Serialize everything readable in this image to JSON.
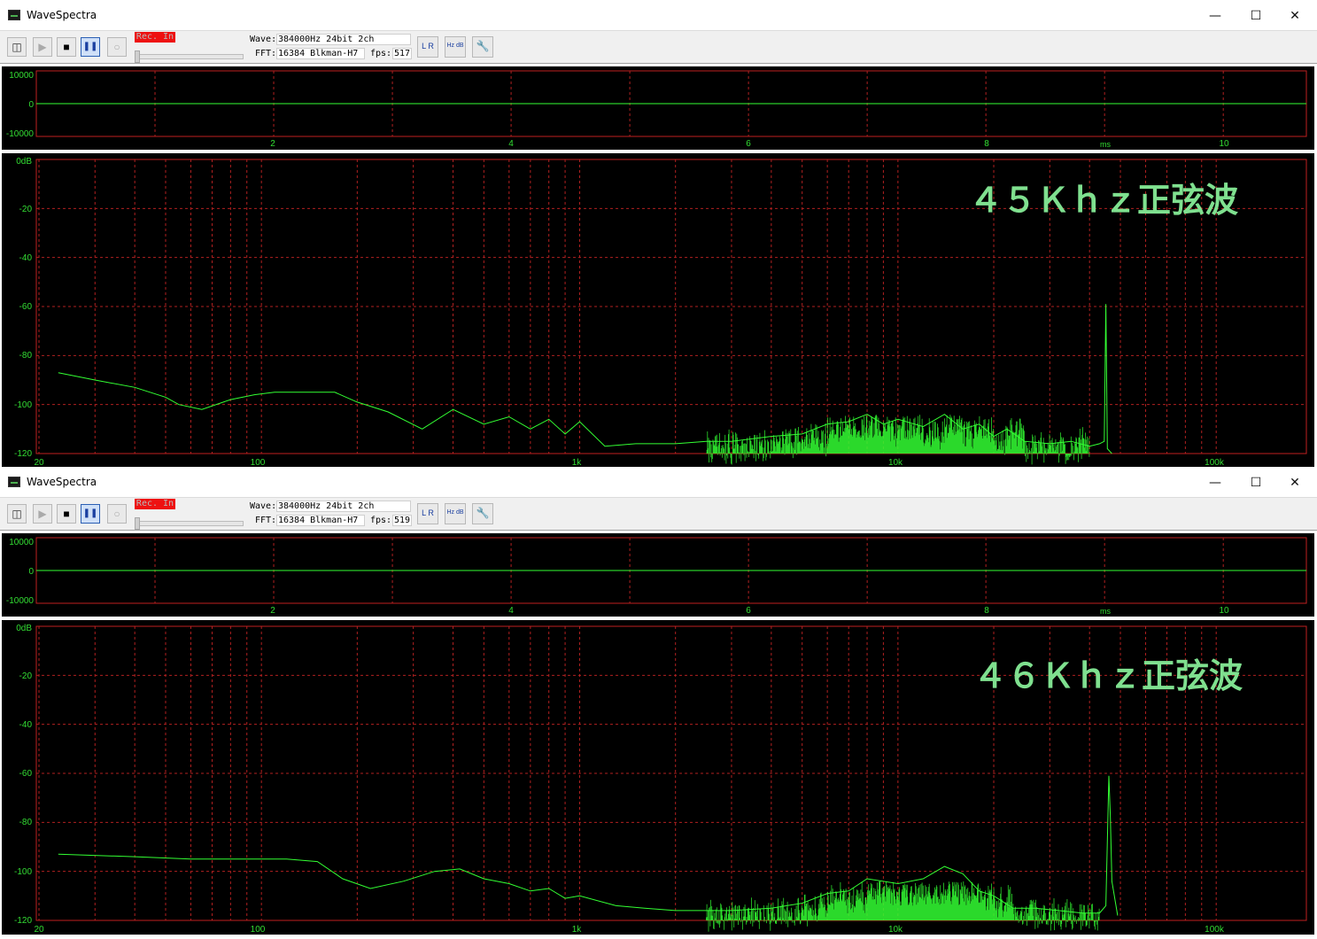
{
  "windows": [
    {
      "title": "WaveSpectra",
      "controls": {
        "minimize": "—",
        "maximize": "☐",
        "close": "✕"
      },
      "toolbar": {
        "rec_label": "Rec. In",
        "wave_label": "Wave:",
        "wave_value": "384000Hz 24bit 2ch",
        "fft_label": "FFT:",
        "fft_value": "16384 Blkman-H7",
        "fps_label": "fps:",
        "fps_value": "517",
        "buttons": [
          {
            "name": "device-icon",
            "glyph": "◫",
            "active": false
          },
          {
            "name": "play-icon",
            "glyph": "▶",
            "active": false
          },
          {
            "name": "stop-icon",
            "glyph": "■",
            "active": false
          },
          {
            "name": "pause-icon",
            "glyph": "❚❚",
            "active": true
          },
          {
            "name": "record-icon",
            "glyph": "○",
            "active": false
          }
        ],
        "right_buttons": [
          {
            "name": "channel-lr-icon",
            "glyph": "L R"
          },
          {
            "name": "hz-db-icon",
            "glyph": "Hz dB"
          },
          {
            "name": "settings-wrench-icon",
            "glyph": "🔧"
          }
        ]
      },
      "waveform": {
        "y_ticks": [
          "10000",
          "0",
          "-10000"
        ],
        "x_ticks": [
          "2",
          "4",
          "6",
          "8",
          "10"
        ],
        "x_unit": "ms"
      },
      "spectrum": {
        "annotation": "４５Ｋｈｚ正弦波",
        "y_ticks": [
          "0dB",
          "-20",
          "-40",
          "-60",
          "-80",
          "-100",
          "-120"
        ],
        "x_ticks": [
          "20",
          "100",
          "1k",
          "10k",
          "100k"
        ]
      }
    },
    {
      "title": "WaveSpectra",
      "controls": {
        "minimize": "—",
        "maximize": "☐",
        "close": "✕"
      },
      "toolbar": {
        "rec_label": "Rec. In",
        "wave_label": "Wave:",
        "wave_value": "384000Hz 24bit 2ch",
        "fft_label": "FFT:",
        "fft_value": "16384 Blkman-H7",
        "fps_label": "fps:",
        "fps_value": "519",
        "buttons": [
          {
            "name": "device-icon",
            "glyph": "◫",
            "active": false
          },
          {
            "name": "play-icon",
            "glyph": "▶",
            "active": false
          },
          {
            "name": "stop-icon",
            "glyph": "■",
            "active": false
          },
          {
            "name": "pause-icon",
            "glyph": "❚❚",
            "active": true
          },
          {
            "name": "record-icon",
            "glyph": "○",
            "active": false
          }
        ],
        "right_buttons": [
          {
            "name": "channel-lr-icon",
            "glyph": "L R"
          },
          {
            "name": "hz-db-icon",
            "glyph": "Hz dB"
          },
          {
            "name": "settings-wrench-icon",
            "glyph": "🔧"
          }
        ]
      },
      "waveform": {
        "y_ticks": [
          "10000",
          "0",
          "-10000"
        ],
        "x_ticks": [
          "2",
          "4",
          "6",
          "8",
          "10"
        ],
        "x_unit": "ms"
      },
      "spectrum": {
        "annotation": "４６Ｋｈｚ正弦波",
        "y_ticks": [
          "0dB",
          "-20",
          "-40",
          "-60",
          "-80",
          "-100",
          "-120"
        ],
        "x_ticks": [
          "20",
          "100",
          "1k",
          "10k",
          "100k"
        ]
      }
    }
  ],
  "colors": {
    "plot_bg": "#000000",
    "grid": "#b02020",
    "trace": "#33ff33",
    "axis_text": "#33dd33",
    "annotation": "#7fe08f"
  },
  "chart_data": [
    {
      "type": "line",
      "title": "",
      "xlabel": "ms",
      "ylabel": "",
      "xlim": [
        0,
        10.7
      ],
      "ylim": [
        -10000,
        10000
      ],
      "x": [
        0,
        10.7
      ],
      "series": [
        {
          "values": [
            0,
            0
          ]
        }
      ]
    },
    {
      "type": "line",
      "title": "４５Ｋｈｚ正弦波",
      "xlabel": "",
      "ylabel": "",
      "x_scale": "log",
      "xlim": [
        20,
        192000
      ],
      "ylim": [
        -120,
        0
      ],
      "x": [
        23,
        30,
        40,
        50,
        55,
        65,
        80,
        95,
        110,
        140,
        170,
        200,
        250,
        320,
        400,
        500,
        600,
        700,
        800,
        900,
        1000,
        1200,
        1500,
        2000,
        2500,
        3000,
        4000,
        5000,
        6000,
        7000,
        8000,
        9000,
        10000,
        12000,
        14000,
        16000,
        18000,
        20000,
        22000,
        25000,
        30000,
        35000,
        40000,
        43000,
        44500,
        45000,
        45500,
        47000
      ],
      "series": [
        {
          "values": [
            -87,
            -90,
            -93,
            -97,
            -100,
            -102,
            -98,
            -96,
            -95,
            -95,
            -95,
            -99,
            -103,
            -110,
            -102,
            -108,
            -105,
            -110,
            -106,
            -112,
            -107,
            -117,
            -116,
            -116,
            -115,
            -115,
            -113,
            -112,
            -108,
            -107,
            -104,
            -108,
            -106,
            -109,
            -104,
            -110,
            -108,
            -113,
            -110,
            -115,
            -116,
            -115,
            -117,
            -116,
            -115,
            -59,
            -118,
            -120
          ]
        }
      ]
    },
    {
      "type": "line",
      "title": "",
      "xlabel": "ms",
      "ylabel": "",
      "xlim": [
        0,
        10.7
      ],
      "ylim": [
        -10000,
        10000
      ],
      "x": [
        0,
        10.7
      ],
      "series": [
        {
          "values": [
            0,
            0
          ]
        }
      ]
    },
    {
      "type": "line",
      "title": "４６Ｋｈｚ正弦波",
      "xlabel": "",
      "ylabel": "",
      "x_scale": "log",
      "xlim": [
        20,
        192000
      ],
      "ylim": [
        -120,
        0
      ],
      "x": [
        23,
        40,
        60,
        80,
        100,
        120,
        150,
        180,
        220,
        280,
        350,
        420,
        500,
        600,
        700,
        800,
        900,
        1000,
        1300,
        1600,
        2000,
        2500,
        3000,
        4000,
        5000,
        6000,
        7000,
        8000,
        10000,
        12000,
        14000,
        16000,
        18000,
        20000,
        23000,
        27000,
        32000,
        38000,
        43000,
        45000,
        46000,
        46500,
        47000,
        49000
      ],
      "series": [
        {
          "values": [
            -93,
            -94,
            -95,
            -95,
            -95,
            -95,
            -96,
            -103,
            -107,
            -104,
            -100,
            -99,
            -103,
            -105,
            -108,
            -107,
            -111,
            -110,
            -114,
            -115,
            -116,
            -116,
            -116,
            -115,
            -113,
            -109,
            -108,
            -103,
            -105,
            -103,
            -98,
            -101,
            -108,
            -110,
            -115,
            -115,
            -116,
            -117,
            -117,
            -114,
            -61,
            -78,
            -104,
            -118
          ]
        }
      ]
    }
  ]
}
